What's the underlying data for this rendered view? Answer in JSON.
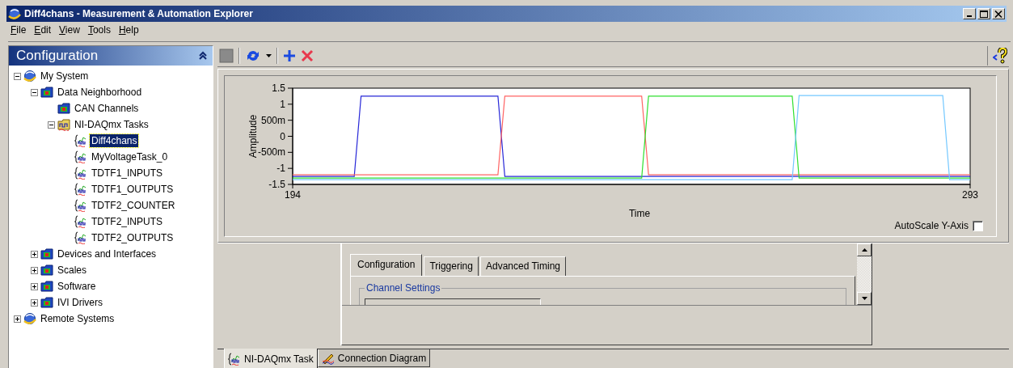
{
  "window": {
    "title": "Diff4chans - Measurement & Automation Explorer"
  },
  "menu": [
    "File",
    "Edit",
    "View",
    "Tools",
    "Help"
  ],
  "sidebar": {
    "title": "Configuration",
    "tree": [
      {
        "label": "My System",
        "kind": "globe",
        "expanded": true,
        "selected": false,
        "children": [
          {
            "label": "Data Neighborhood",
            "kind": "folder",
            "expanded": true,
            "selected": false,
            "children": [
              {
                "label": "CAN Channels",
                "kind": "folder",
                "selected": false
              },
              {
                "label": "NI-DAQmx Tasks",
                "kind": "tasks",
                "expanded": true,
                "selected": false,
                "children": [
                  {
                    "label": "Diff4chans",
                    "kind": "task",
                    "selected": true
                  },
                  {
                    "label": "MyVoltageTask_0",
                    "kind": "task",
                    "selected": false
                  },
                  {
                    "label": "TDTF1_INPUTS",
                    "kind": "task",
                    "selected": false
                  },
                  {
                    "label": "TDTF1_OUTPUTS",
                    "kind": "task",
                    "selected": false
                  },
                  {
                    "label": "TDTF2_COUNTER",
                    "kind": "task",
                    "selected": false
                  },
                  {
                    "label": "TDTF2_INPUTS",
                    "kind": "task",
                    "selected": false
                  },
                  {
                    "label": "TDTF2_OUTPUTS",
                    "kind": "task",
                    "selected": false
                  }
                ]
              }
            ]
          },
          {
            "label": "Devices and Interfaces",
            "kind": "folder",
            "expanded": false,
            "selected": false
          },
          {
            "label": "Scales",
            "kind": "folder",
            "expanded": false,
            "selected": false
          },
          {
            "label": "Software",
            "kind": "folder",
            "expanded": false,
            "selected": false
          },
          {
            "label": "IVI Drivers",
            "kind": "folder",
            "expanded": false,
            "selected": false
          }
        ]
      },
      {
        "label": "Remote Systems",
        "kind": "globe",
        "expanded": false,
        "selected": false
      }
    ]
  },
  "graph": {
    "chart_data": {
      "type": "line",
      "xlabel": "Time",
      "ylabel": "Amplitude",
      "x": [
        194,
        203,
        204,
        224,
        225,
        245,
        246,
        267,
        268,
        289,
        290,
        293
      ],
      "series": [
        {
          "color": "#2828d8",
          "values": [
            -1.25,
            -1.25,
            1.25,
            1.25,
            -1.25,
            -1.25,
            -1.25,
            -1.25,
            -1.25,
            -1.25,
            -1.25,
            -1.25
          ]
        },
        {
          "color": "#ff6464",
          "values": [
            -1.2,
            -1.2,
            -1.2,
            -1.2,
            1.25,
            1.25,
            -1.2,
            -1.2,
            -1.2,
            -1.2,
            -1.2,
            -1.2
          ]
        },
        {
          "color": "#30e030",
          "values": [
            -1.3,
            -1.3,
            -1.3,
            -1.3,
            -1.3,
            -1.3,
            1.25,
            1.25,
            -1.3,
            -1.3,
            -1.3,
            -1.3
          ]
        },
        {
          "color": "#74c8ff",
          "values": [
            -1.35,
            -1.35,
            -1.35,
            -1.35,
            -1.35,
            -1.35,
            -1.35,
            -1.35,
            1.27,
            1.27,
            -1.35,
            -1.35
          ]
        }
      ],
      "xlim": [
        194,
        293
      ],
      "ylim": [
        -1.5,
        1.5
      ],
      "xticks": [
        194,
        293
      ],
      "yticks": [
        1.5,
        1,
        0,
        -1,
        -1.5
      ]
    },
    "y_midpoint_tick_labels": [
      "500m",
      "-500m"
    ],
    "autoscale": {
      "label": "AutoScale Y-Axis",
      "checked": false
    }
  },
  "task_tabs": [
    {
      "label": "Configuration",
      "selected": true
    },
    {
      "label": "Triggering",
      "selected": false
    },
    {
      "label": "Advanced Timing",
      "selected": false
    }
  ],
  "channel_settings": {
    "title": "Channel Settings"
  },
  "view_tabs": [
    {
      "label": "NI-DAQmx Task",
      "kind": "task",
      "selected": true
    },
    {
      "label": "Connection Diagram",
      "kind": "diagram",
      "selected": false
    }
  ]
}
